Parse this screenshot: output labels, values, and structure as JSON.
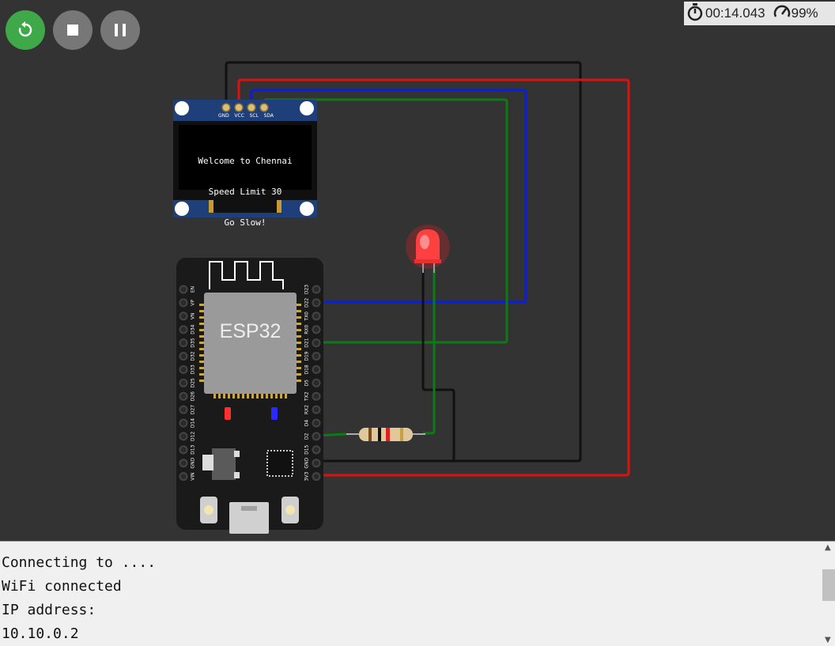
{
  "controls": {
    "restart": "restart-icon",
    "stop": "stop-icon",
    "pause": "pause-icon"
  },
  "status": {
    "timer": "00:14.043",
    "speed": "99%"
  },
  "oled": {
    "pins": [
      "GND",
      "VCC",
      "SCL",
      "SDA"
    ],
    "lines": [
      "Welcome to Chennai",
      "Speed Limit 30",
      "Go Slow!"
    ]
  },
  "esp32": {
    "chip_label": "ESP32",
    "left_pins": [
      "EN",
      "VP",
      "VN",
      "D34",
      "D35",
      "D32",
      "D33",
      "D25",
      "D26",
      "D27",
      "D14",
      "D12",
      "D13",
      "GND",
      "VIN"
    ],
    "right_pins": [
      "D23",
      "D22",
      "TX0",
      "RX0",
      "D21",
      "D19",
      "D18",
      "D5",
      "TX2",
      "RX2",
      "D4",
      "D2",
      "D15",
      "GND",
      "3V3"
    ]
  },
  "serial": {
    "lines": [
      "Connecting to ....",
      "WiFi connected",
      "IP address:",
      "10.10.0.2"
    ]
  },
  "colors": {
    "wire_black": "#111111",
    "wire_red": "#e01010",
    "wire_blue": "#0a1ee0",
    "wire_green": "#0e7a16",
    "led": "#ff3030",
    "board": "#1a1a1a",
    "oled_pcb": "#1e3f7a",
    "restart": "#3fa94a"
  }
}
